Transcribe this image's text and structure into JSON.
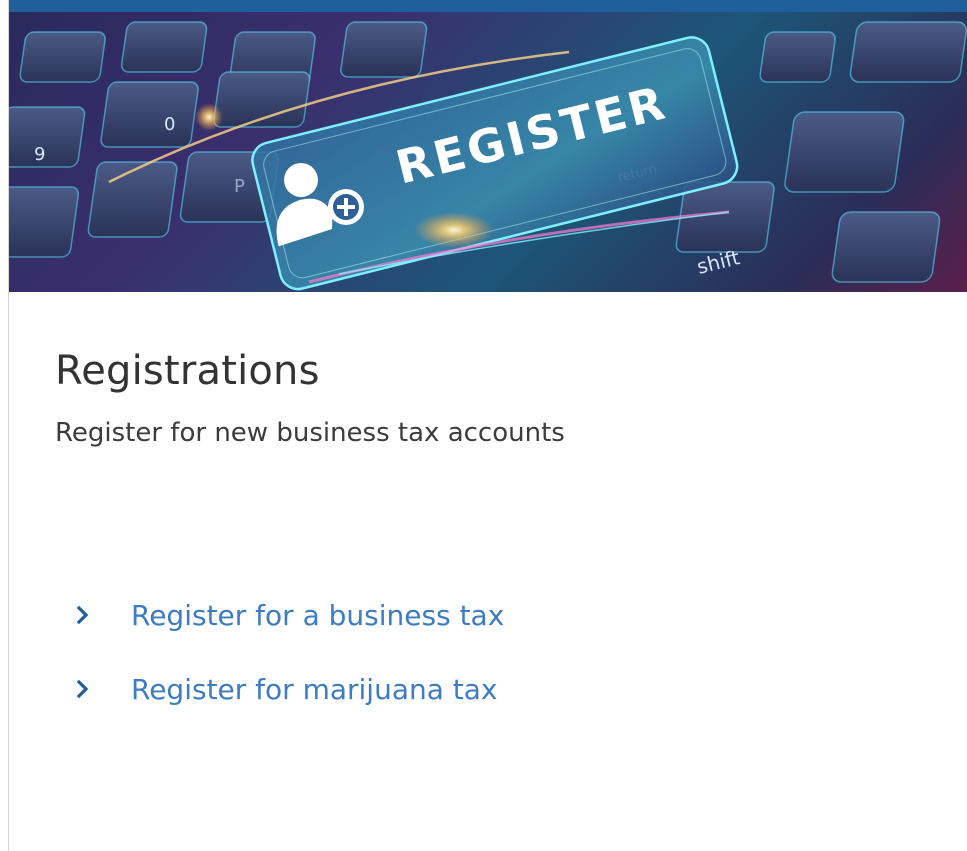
{
  "banner": {
    "label": "REGISTER",
    "key_labels": [
      "9",
      "0",
      "P",
      "return",
      "shift"
    ]
  },
  "card": {
    "title": "Registrations",
    "subtitle": "Register for new business tax accounts"
  },
  "links": [
    {
      "label": "Register for a business tax"
    },
    {
      "label": "Register for marijuana tax"
    }
  ],
  "colors": {
    "accent_bar": "#1f5f9c",
    "link": "#3d7cc2",
    "chevron": "#1f5f9c",
    "title": "#333333"
  }
}
